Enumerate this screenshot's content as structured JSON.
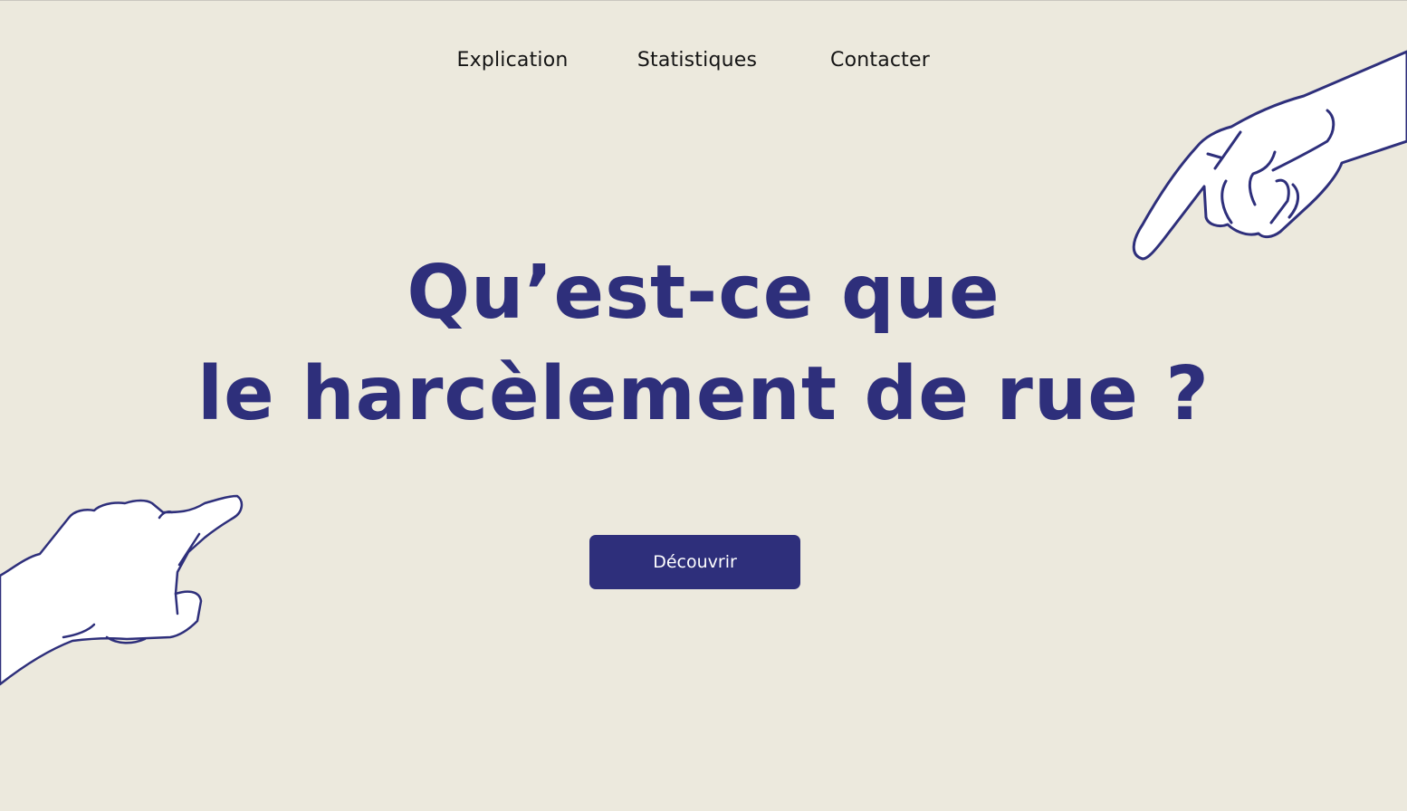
{
  "nav": {
    "items": [
      {
        "label": "Explication"
      },
      {
        "label": "Statistiques"
      },
      {
        "label": "Contacter"
      }
    ]
  },
  "hero": {
    "title_line1": "Qu’est-ce que",
    "title_line2": "le harcèlement de rue ?",
    "cta_label": "Découvrir"
  },
  "theme": {
    "background": "#ece9dd",
    "accent": "#2e2f7b",
    "nav_text": "#141414",
    "hand_fill": "#ffffff"
  },
  "illustrations": {
    "top_right": "pointing-hand-icon",
    "bottom_left": "pointing-hand-icon"
  }
}
